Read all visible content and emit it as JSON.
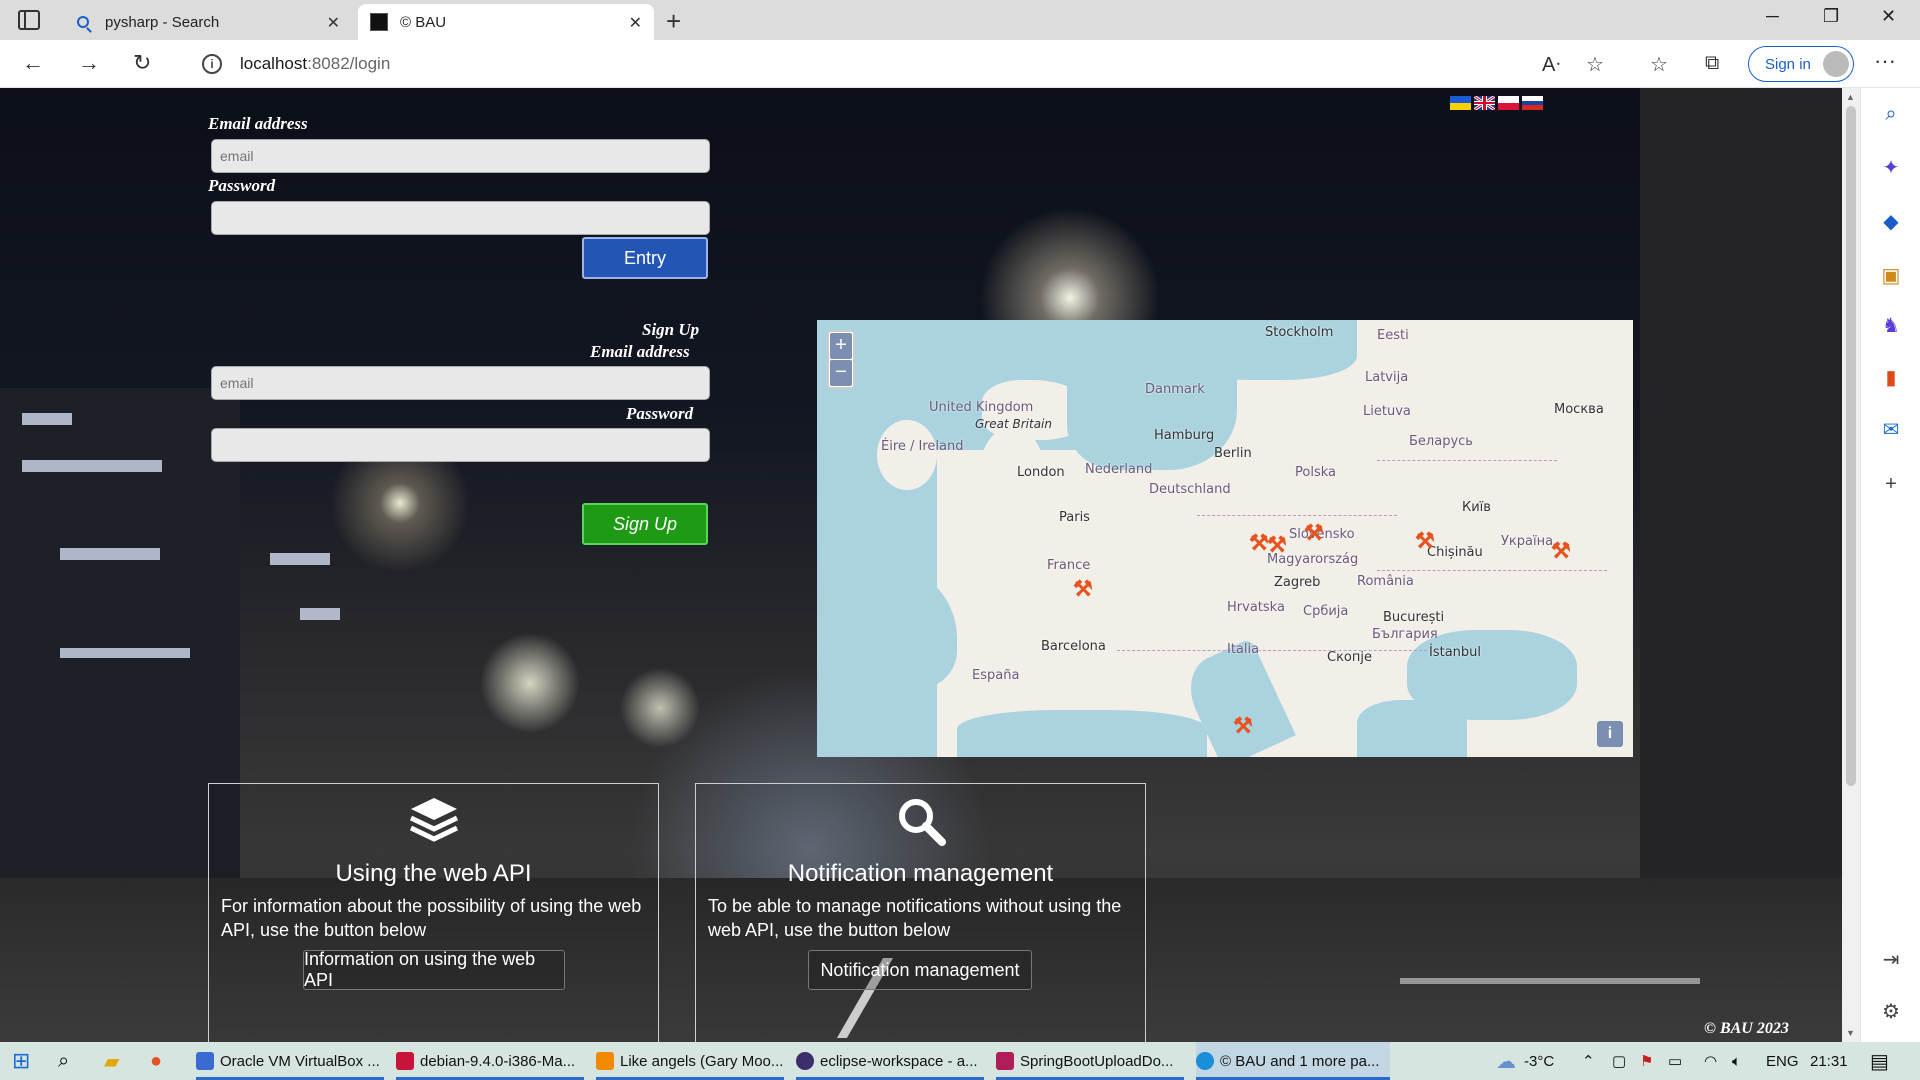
{
  "browser": {
    "tabs": [
      {
        "title": "pysharp - Search",
        "icon": "search-icon"
      },
      {
        "title": "© BAU",
        "icon": "bau-favicon"
      }
    ],
    "address": {
      "host": "localhost",
      "path": ":8082/login"
    },
    "signin_label": "Sign in"
  },
  "login": {
    "email_label": "Email address",
    "email_placeholder": "email",
    "password_label": "Password",
    "entry_label": "Entry"
  },
  "signup": {
    "heading": "Sign Up",
    "email_label": "Email address",
    "email_placeholder": "email",
    "password_label": "Password",
    "button_label": "Sign Up"
  },
  "languages": [
    "ua",
    "uk",
    "pl",
    "ru"
  ],
  "map": {
    "zoom_in": "+",
    "zoom_out": "−",
    "attribution": "i",
    "labels": [
      "Stockholm",
      "Eesti",
      "Latvija",
      "Danmark",
      "Lietuva",
      "Москва",
      "United Kingdom",
      "Great Britain",
      "Éire / Ireland",
      "Hamburg",
      "Berlin",
      "Беларусь",
      "London",
      "Nederland",
      "Polska",
      "Deutschland",
      "Київ",
      "Paris",
      "Slovensko",
      "Україна",
      "Chișinău",
      "France",
      "Magyarország",
      "Zagreb",
      "România",
      "Hrvatska",
      "Србија",
      "București",
      "България",
      "Barcelona",
      "Italia",
      "Скопје",
      "İstanbul",
      "España"
    ]
  },
  "cards": [
    {
      "title": "Using the web API",
      "description": "For information about the possibility of using the web API, use the button below",
      "button": "Information on using the web API",
      "icon": "layers-icon"
    },
    {
      "title": "Notification management",
      "description": "To be able to manage notifications without using the web API, use the button below",
      "button": "Notification management",
      "icon": "search-icon"
    }
  ],
  "copyright": "© BAU 2023",
  "taskbar": {
    "items": [
      "Oracle VM VirtualBox ...",
      "debian-9.4.0-i386-Ma...",
      "Like angels (Gary Moo...",
      "eclipse-workspace - a...",
      "SpringBootUploadDo...",
      "© BAU and 1 more pa..."
    ],
    "weather": "-3°C",
    "lang": "ENG",
    "time": "21:31"
  }
}
